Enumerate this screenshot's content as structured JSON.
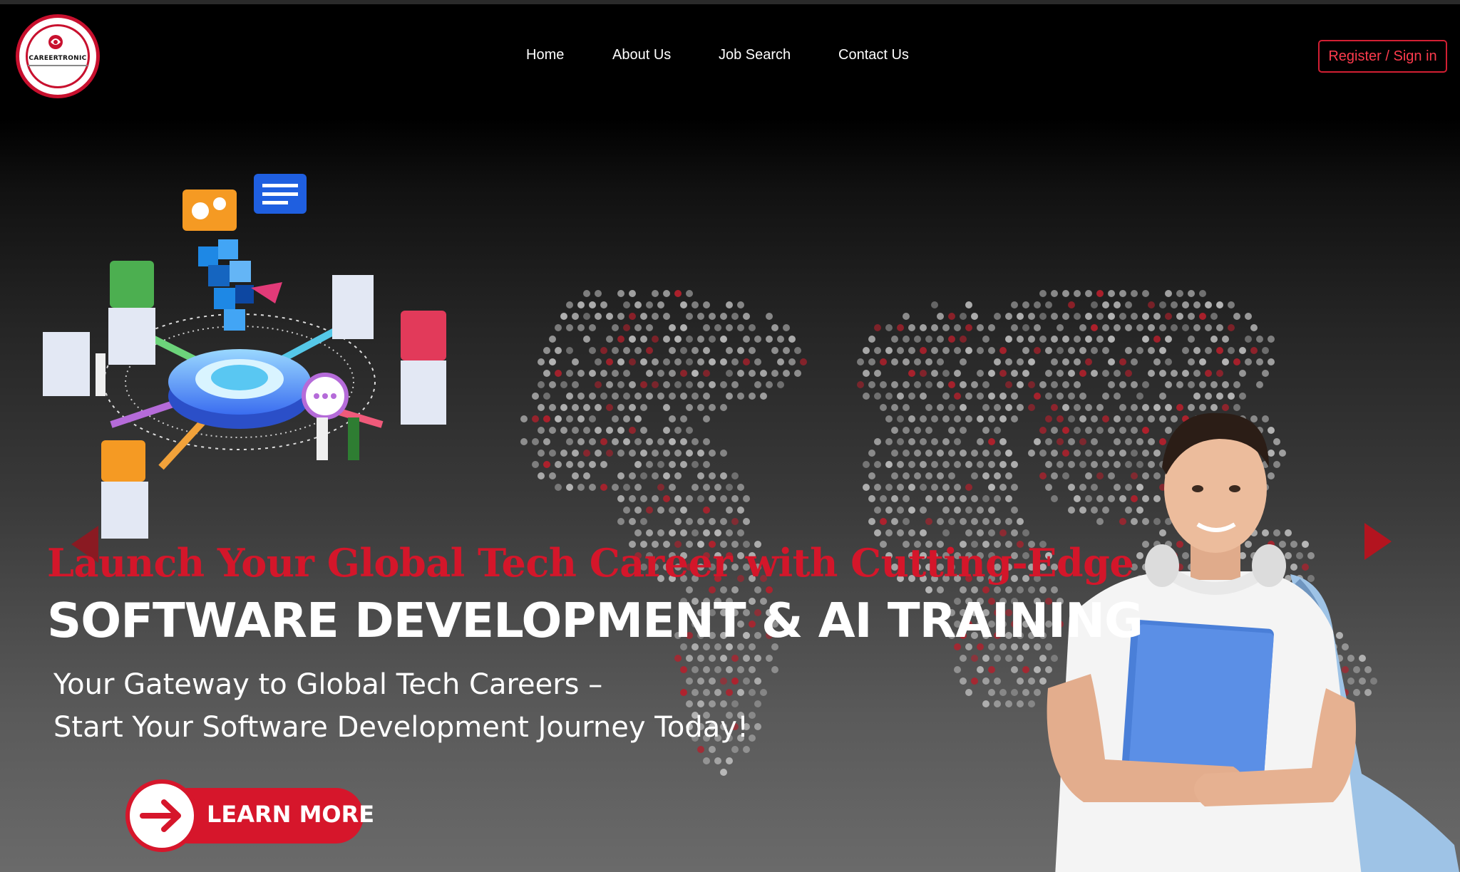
{
  "header": {
    "logo_text": "CAREERTRONIC",
    "nav": [
      "Home",
      "About Us",
      "Job Search",
      "Contact Us"
    ],
    "register_label": "Register / Sign in"
  },
  "hero": {
    "headline_red": "Launch Your Global Tech Career with Cutting-Edge",
    "headline_white": "SOFTWARE DEVELOPMENT & AI TRAINING",
    "subtitle_line1": "Your Gateway to Global Tech Careers –",
    "subtitle_line2": "Start Your Software Development Journey Today!",
    "cta_label": "LEARN MORE"
  },
  "colors": {
    "accent": "#d4162a",
    "background": "#000000",
    "text": "#ffffff"
  },
  "icons": [
    "prev-arrow-icon",
    "next-arrow-icon",
    "arrow-right-icon"
  ]
}
